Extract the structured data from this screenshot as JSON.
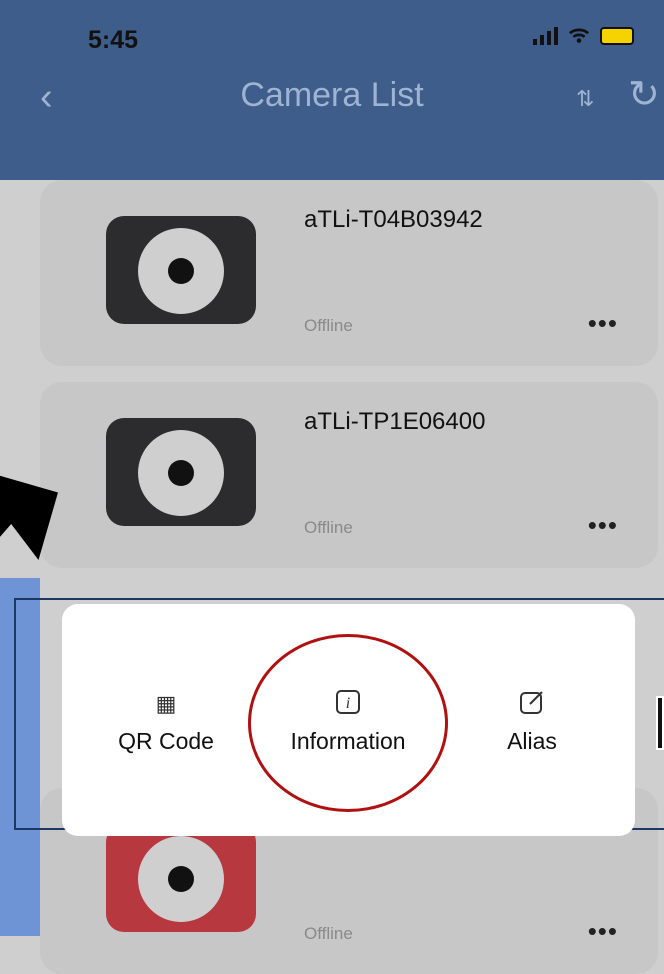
{
  "status_bar": {
    "time": "5:45"
  },
  "header": {
    "title": "Camera List"
  },
  "cameras": [
    {
      "name": "aTLi-T04B03942",
      "status": "Offline",
      "more": "•••"
    },
    {
      "name": "aTLi-TP1E06400",
      "status": "Offline",
      "more": "•••"
    },
    {
      "name": "",
      "status": "Offline",
      "more": "•••"
    }
  ],
  "popup": {
    "items": [
      {
        "label": "QR Code",
        "icon": "qr-code-icon"
      },
      {
        "label": "Information",
        "icon": "info-icon"
      },
      {
        "label": "Alias",
        "icon": "edit-icon"
      }
    ]
  },
  "colors": {
    "header": "#3f5d8a",
    "annotation_red": "#b11010",
    "annotation_blue": "#6f94d6"
  }
}
